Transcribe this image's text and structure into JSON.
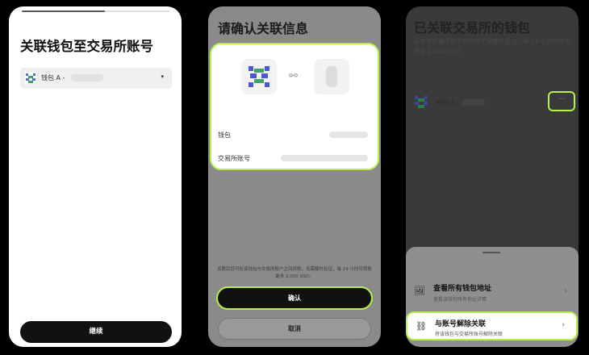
{
  "screen1": {
    "title": "关联钱包至交易所账号",
    "select_label": "钱包 A -",
    "caret": "▾",
    "continue_label": "继续"
  },
  "screen2": {
    "title": "请确认关联信息",
    "link_glyph": "⚯",
    "wallet_label": "钱包",
    "exchange_label": "交易所账号",
    "notice": "关联后您可在该钱包与交易所账户之间转账，无需额外验证，每 24 小时可转账最多 2,000 USD。",
    "confirm_label": "确认",
    "cancel_label": "取消"
  },
  "screen3": {
    "title": "已关联交易所的钱包",
    "subtitle": "从交易所提币到关联钱包无需额外验证，每 24 小时可提币最多 2,000 USD",
    "wallet_label": "钱包 A -",
    "more": "···",
    "item1_title": "查看所有钱包地址",
    "item1_sub": "查看该钱包所有地址详情",
    "item1_icon": "🖼",
    "item2_title": "与账号解除关联",
    "item2_sub": "将该钱包与交易所账号解除关联",
    "item2_icon": "⛓",
    "chevron": "›"
  },
  "colors": {
    "accent": "#b7f04d",
    "dark": "#111111"
  }
}
